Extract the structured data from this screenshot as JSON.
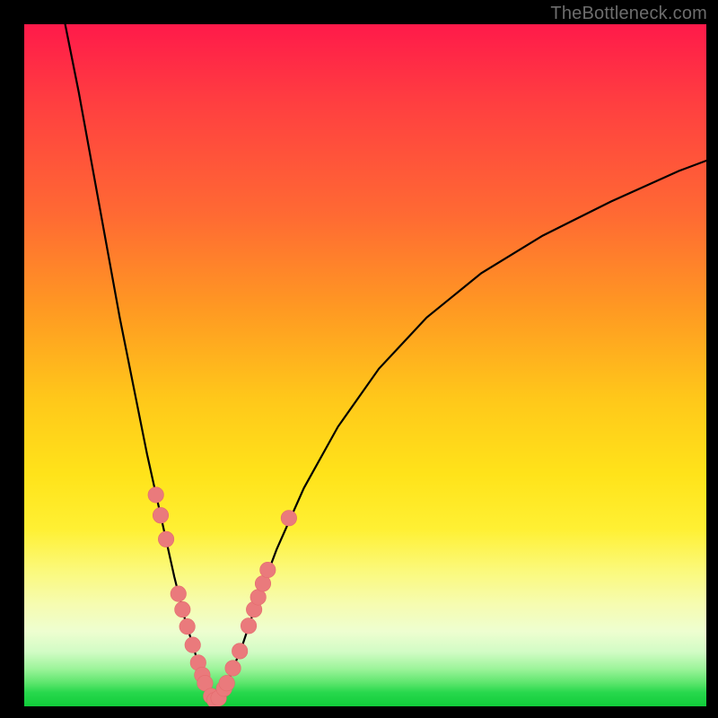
{
  "watermark": "TheBottleneck.com",
  "colors": {
    "frame": "#000000",
    "curve": "#000000",
    "marker_fill": "#ea7a7c",
    "marker_stroke": "#e46b6d",
    "gradient_top": "#ff1a4a",
    "gradient_bottom": "#11cc3a"
  },
  "chart_data": {
    "type": "line",
    "title": "",
    "xlabel": "",
    "ylabel": "",
    "xlim": [
      0,
      100
    ],
    "ylim": [
      0,
      100
    ],
    "note": "Axes are unlabeled; values are percentage of plot area. y=0 at bottom, x=0 at left. Two curves form a V/valley shape with minimum near x≈27, y≈0. Markers cluster along both curves near the valley.",
    "series": [
      {
        "name": "left-curve",
        "x": [
          6,
          8,
          10,
          12,
          14,
          16,
          18,
          20,
          22,
          23.5,
          25,
          26,
          27,
          28
        ],
        "y": [
          100,
          90,
          79,
          68,
          57,
          47,
          37,
          28,
          19,
          13,
          8,
          4.5,
          2,
          0.8
        ]
      },
      {
        "name": "right-curve",
        "x": [
          28,
          29,
          30,
          32,
          34,
          37,
          41,
          46,
          52,
          59,
          67,
          76,
          86,
          96,
          100
        ],
        "y": [
          0.8,
          2,
          4,
          9,
          15,
          23,
          32,
          41,
          49.5,
          57,
          63.5,
          69,
          74,
          78.5,
          80
        ]
      }
    ],
    "markers": {
      "name": "highlighted-points",
      "points": [
        {
          "x": 19.3,
          "y": 31
        },
        {
          "x": 20.0,
          "y": 28
        },
        {
          "x": 20.8,
          "y": 24.5
        },
        {
          "x": 22.6,
          "y": 16.5
        },
        {
          "x": 23.2,
          "y": 14.2
        },
        {
          "x": 23.9,
          "y": 11.7
        },
        {
          "x": 24.7,
          "y": 9.0
        },
        {
          "x": 25.5,
          "y": 6.4
        },
        {
          "x": 26.1,
          "y": 4.6
        },
        {
          "x": 26.5,
          "y": 3.4
        },
        {
          "x": 27.4,
          "y": 1.5
        },
        {
          "x": 27.9,
          "y": 0.9
        },
        {
          "x": 28.5,
          "y": 1.2
        },
        {
          "x": 29.3,
          "y": 2.6
        },
        {
          "x": 29.7,
          "y": 3.4
        },
        {
          "x": 30.6,
          "y": 5.6
        },
        {
          "x": 31.6,
          "y": 8.1
        },
        {
          "x": 32.9,
          "y": 11.8
        },
        {
          "x": 33.7,
          "y": 14.2
        },
        {
          "x": 34.3,
          "y": 16.0
        },
        {
          "x": 35.0,
          "y": 18.0
        },
        {
          "x": 35.7,
          "y": 20.0
        },
        {
          "x": 38.8,
          "y": 27.6
        }
      ],
      "radius_percent": 1.15
    }
  }
}
